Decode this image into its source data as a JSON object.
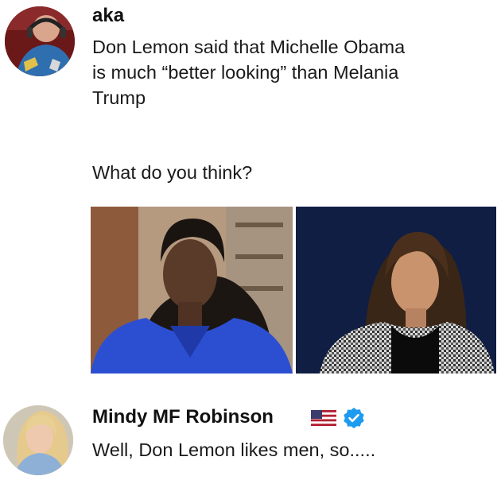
{
  "post": {
    "author": "aka",
    "lines": [
      "Don Lemon said that Michelle Obama",
      "is much “better looking” than Melania",
      "Trump",
      "What do you think?"
    ]
  },
  "reply": {
    "author": "Mindy MF Robinson",
    "text": "Well, Don Lemon likes men, so....."
  }
}
